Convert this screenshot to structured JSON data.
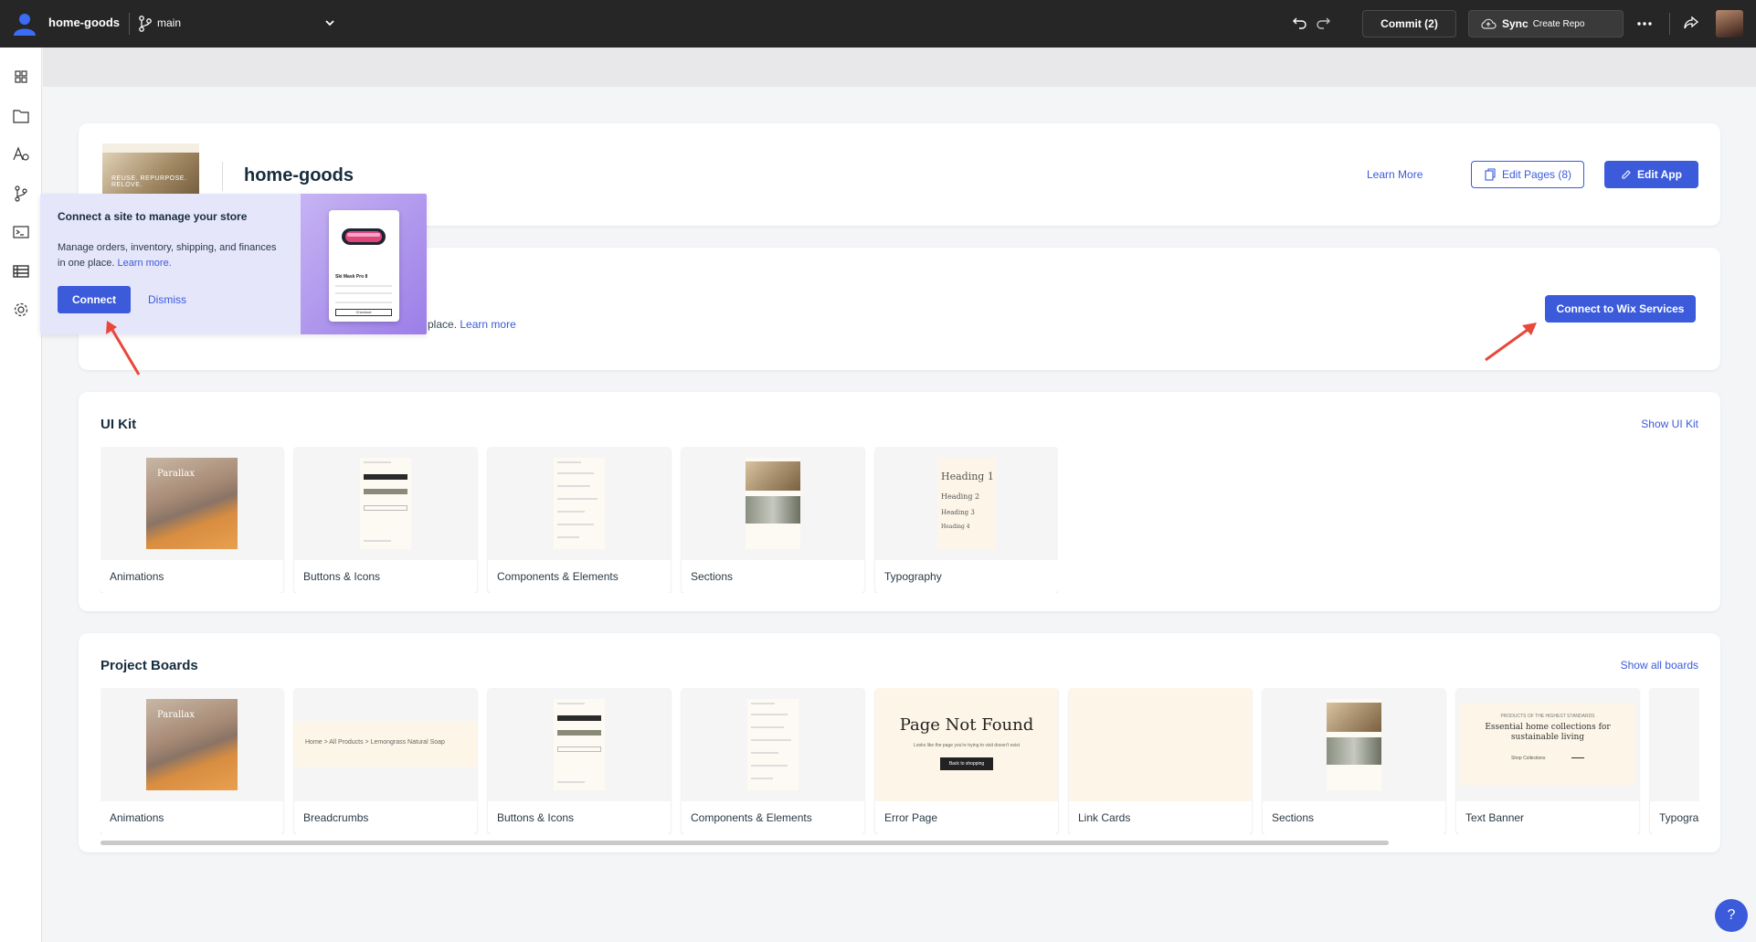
{
  "topbar": {
    "site_name": "home-goods",
    "branch": "main",
    "commit_label": "Commit (2)",
    "sync_label": "Sync",
    "sync_sub": "Create Repo"
  },
  "sidebar": {
    "items": [
      "dashboard-icon",
      "pages-icon",
      "typography-icon",
      "git-icon",
      "terminal-icon",
      "table-icon",
      "settings-icon"
    ]
  },
  "site_card": {
    "thumb_text": "REUSE. REPURPOSE. RELOVE.",
    "title": "home-goods",
    "learn_more": "Learn More",
    "edit_pages": "Edit Pages (8)",
    "edit_app": "Edit App"
  },
  "services_card": {
    "text_visible": "place.",
    "learn_more": "Learn more",
    "connect_button": "Connect to Wix Services"
  },
  "popover": {
    "title": "Connect a site to manage your store",
    "body": "Manage orders, inventory, shipping, and finances in one place.",
    "learn_more": "Learn more.",
    "connect": "Connect",
    "dismiss": "Dismiss",
    "product_name": "Ski Mask Pro 8",
    "product_button": "Checkout"
  },
  "ui_kit": {
    "title": "UI Kit",
    "link": "Show UI Kit",
    "tiles": [
      {
        "label": "Animations",
        "preview_text": "Parallax"
      },
      {
        "label": "Buttons & Icons"
      },
      {
        "label": "Components & Elements"
      },
      {
        "label": "Sections"
      },
      {
        "label": "Typography",
        "headings": [
          "Heading 1",
          "Heading 2",
          "Heading 3",
          "Heading 4"
        ]
      }
    ]
  },
  "project_boards": {
    "title": "Project Boards",
    "link": "Show all boards",
    "tiles": [
      {
        "label": "Animations",
        "preview_text": "Parallax"
      },
      {
        "label": "Breadcrumbs",
        "crumbs": "Home  >  All Products  >  Lemongrass Natural Soap"
      },
      {
        "label": "Buttons & Icons"
      },
      {
        "label": "Components & Elements"
      },
      {
        "label": "Error Page",
        "heading": "Page Not Found",
        "sub": "Looks like the page you're trying to visit doesn't exist",
        "button": "Back to shopping"
      },
      {
        "label": "Link Cards"
      },
      {
        "label": "Sections"
      },
      {
        "label": "Text Banner",
        "small": "PRODUCTS OF THE HIGHEST STANDARDS",
        "main": "Essential home collections for sustainable living",
        "shop": "Shop Collections"
      },
      {
        "label": "Typography"
      }
    ]
  },
  "help_label": "?",
  "colors": {
    "accent": "#3b5bdb",
    "topbar": "#262626",
    "popover": "#e6e6fb",
    "arrow": "#e8473a"
  }
}
